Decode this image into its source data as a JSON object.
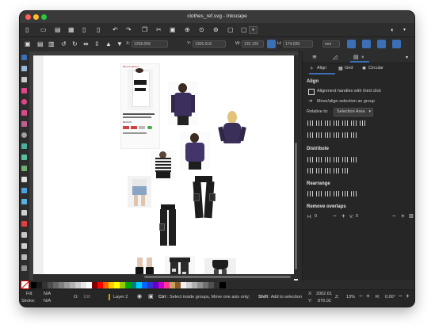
{
  "window": {
    "title": "clothes_ref.svg - Inkscape"
  },
  "toolbar": {
    "x_label": "X:",
    "x_value": "1298.058",
    "y_label": "Y:",
    "y_value": "1306.618",
    "w_label": "W:",
    "w_value": "125.126",
    "h_label": "H:",
    "h_value": "174.028",
    "unit": "mm"
  },
  "panel": {
    "tabs": {
      "align": "Align",
      "grid": "Grid",
      "circular": "Circular"
    },
    "align_heading": "Align",
    "alignment_handles": "Alignment handles with third click",
    "move_align": "Move/align selection as group",
    "relative_label": "Relative to:",
    "relative_value": "Selection Area",
    "distribute_heading": "Distribute",
    "rearrange_heading": "Rearrange",
    "remove_overlaps_heading": "Remove overlaps",
    "h_label": "H:",
    "h_value": "0",
    "v_label": "V:",
    "v_value": "0"
  },
  "status": {
    "fill_label": "Fill:",
    "fill_value": "N/A",
    "stroke_label": "Stroke:",
    "stroke_value": "N/A",
    "opacity_label": "O:",
    "opacity_value": "100",
    "layer": "Layer 2",
    "hint_ctrl": "Ctrl",
    "hint_text": ": Select inside groups, Move one axis only; ",
    "hint_shift": "Shift",
    "hint_text2": ": Add to selection",
    "x_label": "X:",
    "x_value": "2002.61",
    "y_label": "Y:",
    "y_value": "876.02",
    "z_label": "Z:",
    "z_value": "13%",
    "r_label": "R:",
    "r_value": "0.00°"
  },
  "ad": {
    "brand": "Bloomingdale's",
    "price_line": "$110.00"
  },
  "colors": {
    "accent": "#3b6fb6",
    "panel": "#262626",
    "toolbar": "#2d2d2d"
  }
}
